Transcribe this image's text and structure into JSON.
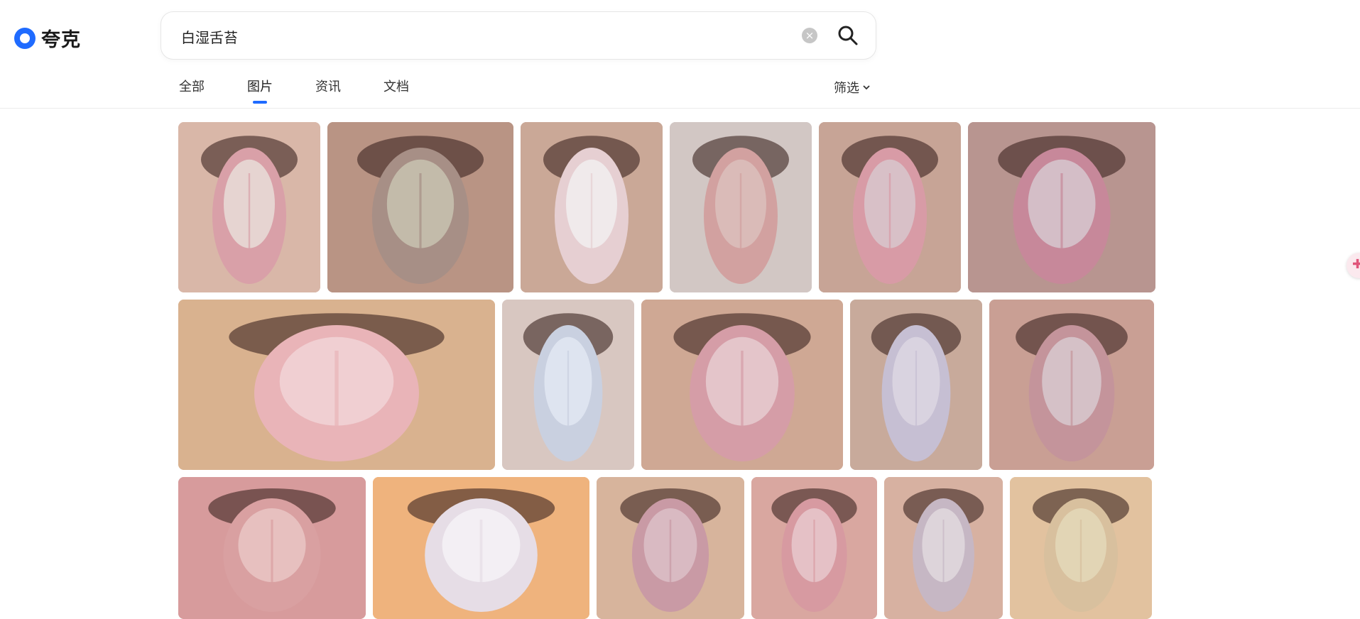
{
  "app": {
    "logo_text": "夸克",
    "logo_icon": "quark-logo-icon"
  },
  "search": {
    "value": "白湿舌苔",
    "clear_label": "×"
  },
  "tabs": [
    {
      "label": "全部",
      "active": false
    },
    {
      "label": "图片",
      "active": true
    },
    {
      "label": "资讯",
      "active": false
    },
    {
      "label": "文档",
      "active": false
    }
  ],
  "filter": {
    "label": "筛选"
  },
  "colors": {
    "accent": "#1f6bff"
  },
  "results": {
    "rows": [
      [
        {
          "bg": "#d9b7a8",
          "tongue": "#d9a0a8",
          "coat": "#e8ddd8"
        },
        {
          "bg": "#b99484",
          "tongue": "#a78f86",
          "coat": "#c8c3b0"
        },
        {
          "bg": "#caa897",
          "tongue": "#e6cfd2",
          "coat": "#f1eef0"
        },
        {
          "bg": "#d2c7c4",
          "tongue": "#d2a1a0",
          "coat": "#dcc0bc"
        },
        {
          "bg": "#c7a496",
          "tongue": "#d89ba6",
          "coat": "#d8c7cc"
        },
        {
          "bg": "#b89590",
          "tongue": "#c7889a",
          "coat": "#d6c8cf"
        }
      ],
      [
        {
          "bg": "#d9b28f",
          "tongue": "#e9b4b8",
          "coat": "#f1d4d6"
        },
        {
          "bg": "#d8c7c1",
          "tongue": "#c9d0e0",
          "coat": "#e2e8f2"
        },
        {
          "bg": "#cfa894",
          "tongue": "#d59da7",
          "coat": "#e6ccd0"
        },
        {
          "bg": "#c8aa9b",
          "tongue": "#c6bfd3",
          "coat": "#dcd6e2"
        },
        {
          "bg": "#c99f94",
          "tongue": "#c4949b",
          "coat": "#d8c9cf"
        }
      ],
      [
        {
          "bg": "#d79b9c",
          "tongue": "#d9a0a1",
          "coat": "#e9c6c4"
        },
        {
          "bg": "#efb37d",
          "tongue": "#e6dde6",
          "coat": "#f5f2f6"
        },
        {
          "bg": "#d7b49c",
          "tongue": "#c99aa5",
          "coat": "#dcc0c7"
        },
        {
          "bg": "#d9a7a0",
          "tongue": "#d79aa1",
          "coat": "#e8c8cc"
        },
        {
          "bg": "#d7b1a1",
          "tongue": "#c6b7c4",
          "coat": "#e0d9de"
        },
        {
          "bg": "#e2c29f",
          "tongue": "#d8c09e",
          "coat": "#e4d8b8"
        }
      ]
    ]
  }
}
